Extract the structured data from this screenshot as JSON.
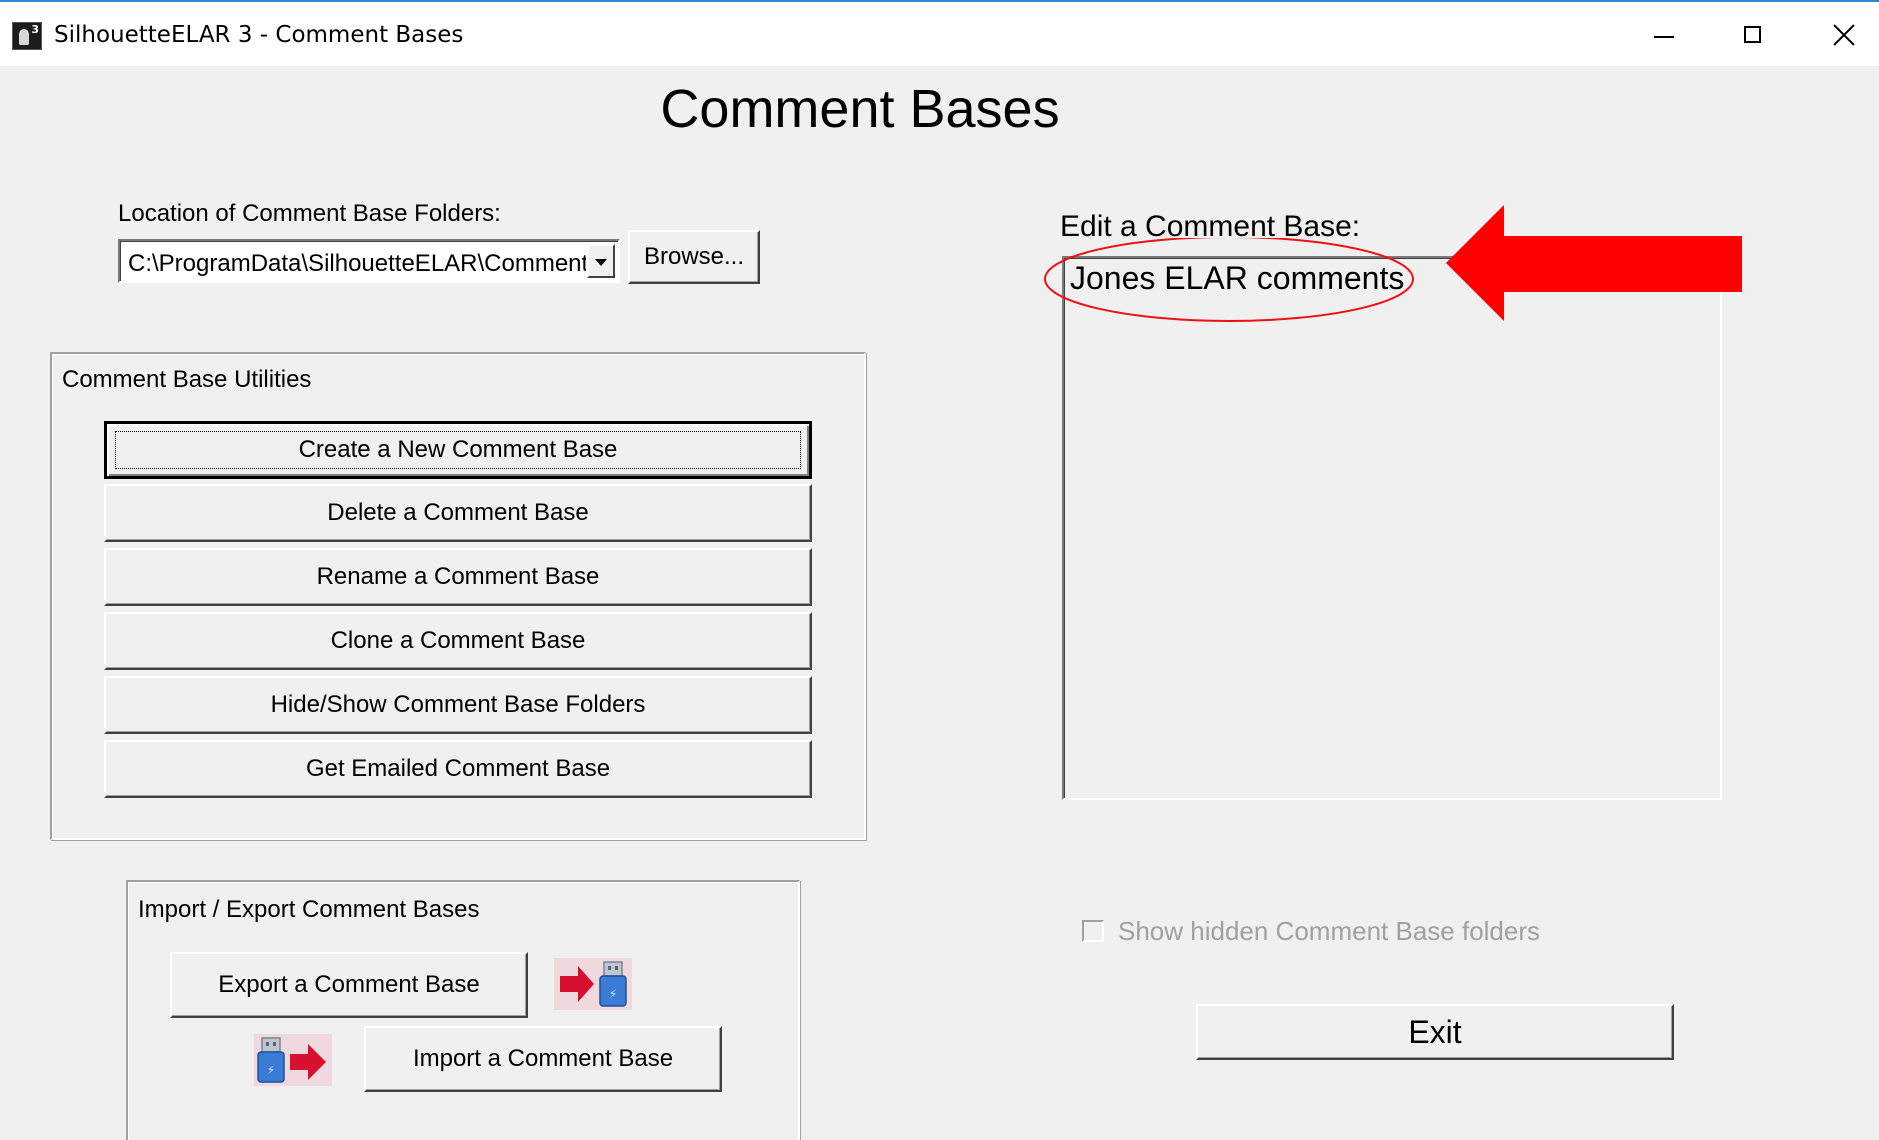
{
  "window": {
    "title": "SilhouetteELAR 3 - Comment Bases",
    "icon_badge": "3"
  },
  "page": {
    "heading": "Comment Bases"
  },
  "location": {
    "label": "Location of Comment Base Folders:",
    "path_value": "C:\\ProgramData\\SilhouetteELAR\\Comment",
    "browse_label": "Browse..."
  },
  "utilities": {
    "group_label": "Comment Base Utilities",
    "buttons": [
      "Create a New Comment Base",
      "Delete a Comment Base",
      "Rename a Comment Base",
      "Clone a Comment Base",
      "Hide/Show Comment Base Folders",
      "Get Emailed Comment Base"
    ]
  },
  "import_export": {
    "group_label": "Import / Export Comment Bases",
    "export_label": "Export a Comment Base",
    "import_label": "Import a Comment Base"
  },
  "edit": {
    "label": "Edit a Comment Base:",
    "items": [
      "Jones ELAR comments"
    ]
  },
  "options": {
    "show_hidden_label": "Show hidden Comment Base folders",
    "show_hidden_checked": false,
    "show_hidden_enabled": false
  },
  "footer": {
    "exit_label": "Exit"
  },
  "colors": {
    "annotation_red": "#ee1111",
    "arrow_red": "#ff0000",
    "usb_blue": "#3a7bd5",
    "usb_arrow": "#d8102f"
  },
  "icons": [
    "app-icon",
    "minimize-icon",
    "maximize-icon",
    "close-icon",
    "dropdown-arrow-icon",
    "export-usb-icon",
    "import-usb-icon",
    "red-arrow-annotation",
    "highlight-ellipse-annotation"
  ]
}
